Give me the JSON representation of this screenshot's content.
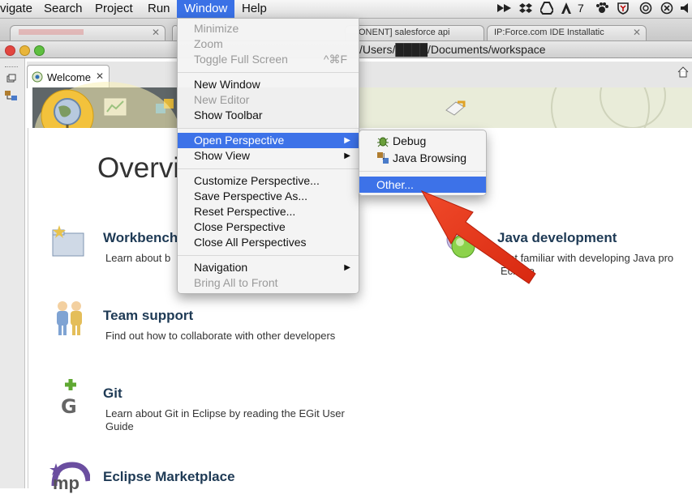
{
  "menubar": {
    "items": [
      "vigate",
      "Search",
      "Project",
      "Run",
      "Window",
      "Help"
    ],
    "tray_badge": "7"
  },
  "browser_tabs": [
    {
      "label": ""
    },
    {
      "label": ""
    },
    {
      "label": "ONENT] salesforce api"
    },
    {
      "label": "IP:Force.com IDE Installatic"
    }
  ],
  "title_path": "/Users/████/Documents/workspace",
  "editor": {
    "tab_label": "Welcome",
    "page_title": "Overvi",
    "items": [
      {
        "title": "Workbench",
        "desc": "Learn about b"
      },
      {
        "title": "Team support",
        "desc": "Find out how to collaborate with other developers"
      },
      {
        "title": "Git",
        "desc": "Learn about Git in Eclipse by reading the EGit User\nGuide"
      },
      {
        "title": "Eclipse Marketplace",
        "desc": ""
      },
      {
        "title": "Java development",
        "desc": "Get familiar with developing Java pro\nEclipse"
      }
    ],
    "icon_text_mp": "mp"
  },
  "window_menu": {
    "minimize": "Minimize",
    "zoom": "Zoom",
    "toggle_full_screen": "Toggle Full Screen",
    "toggle_shortcut": "^⌘F",
    "new_window": "New Window",
    "new_editor": "New Editor",
    "show_toolbar": "Show Toolbar",
    "open_perspective": "Open Perspective",
    "show_view": "Show View",
    "customize_perspective": "Customize Perspective...",
    "save_perspective_as": "Save Perspective As...",
    "reset_perspective": "Reset Perspective...",
    "close_perspective": "Close Perspective",
    "close_all_perspectives": "Close All Perspectives",
    "navigation": "Navigation",
    "bring_all_to_front": "Bring All to Front"
  },
  "perspective_submenu": {
    "debug": "Debug",
    "java_browsing": "Java Browsing",
    "other": "Other..."
  },
  "colors": {
    "selection": "#3d72e8",
    "annotation_arrow": "#e8311c",
    "heading": "#1e3a55"
  }
}
